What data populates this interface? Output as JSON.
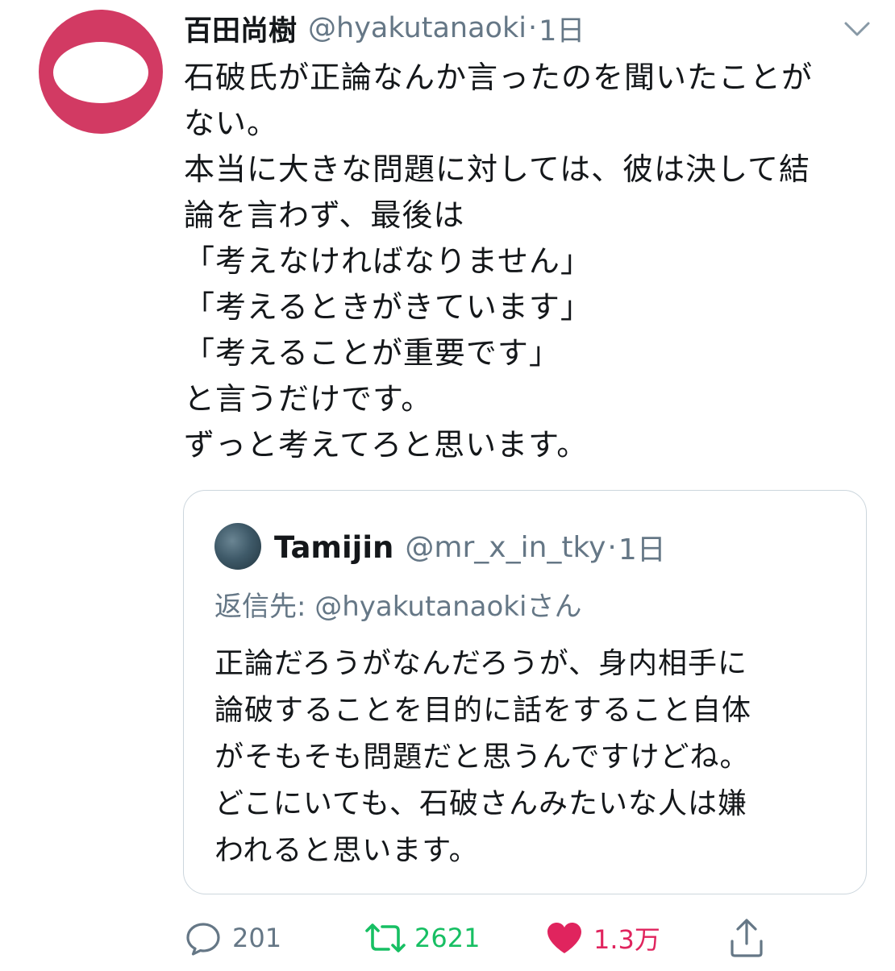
{
  "tweet": {
    "display_name": "百田尚樹",
    "handle": "@hyakutanaoki",
    "separator": "·",
    "time": "1日",
    "lines": [
      "石破氏が正論なんか言ったのを聞いたことが",
      "ない。",
      "本当に大きな問題に対しては、彼は決して結",
      "論を言わず、最後は",
      "「考えなければなりません」",
      "「考えるときがきています」",
      "「考えることが重要です」",
      "と言うだけです。",
      "ずっと考えてろと思います。"
    ]
  },
  "quote": {
    "display_name": "Tamijin",
    "handle": "@mr_x_in_tky",
    "separator": "·",
    "time": "1日",
    "reply_to": "返信先: @hyakutanaokiさん",
    "lines": [
      "正論だろうがなんだろうが、身内相手に",
      "論破することを目的に話をすること自体",
      "がそもそも問題だと思うんですけどね。",
      "どこにいても、石破さんみたいな人は嫌",
      "われると思います。"
    ]
  },
  "actions": {
    "reply": {
      "icon": "comment-icon",
      "count": "201"
    },
    "retweet": {
      "icon": "retweet-icon",
      "count": "2621",
      "color": "#17bf63"
    },
    "like": {
      "icon": "heart-icon",
      "count": "1.3万",
      "color": "#e0245e"
    },
    "share": {
      "icon": "share-icon"
    }
  },
  "colors": {
    "avatar": "#d23a63",
    "muted": "#657786",
    "border": "#ccd6dd",
    "text": "#14171a"
  }
}
